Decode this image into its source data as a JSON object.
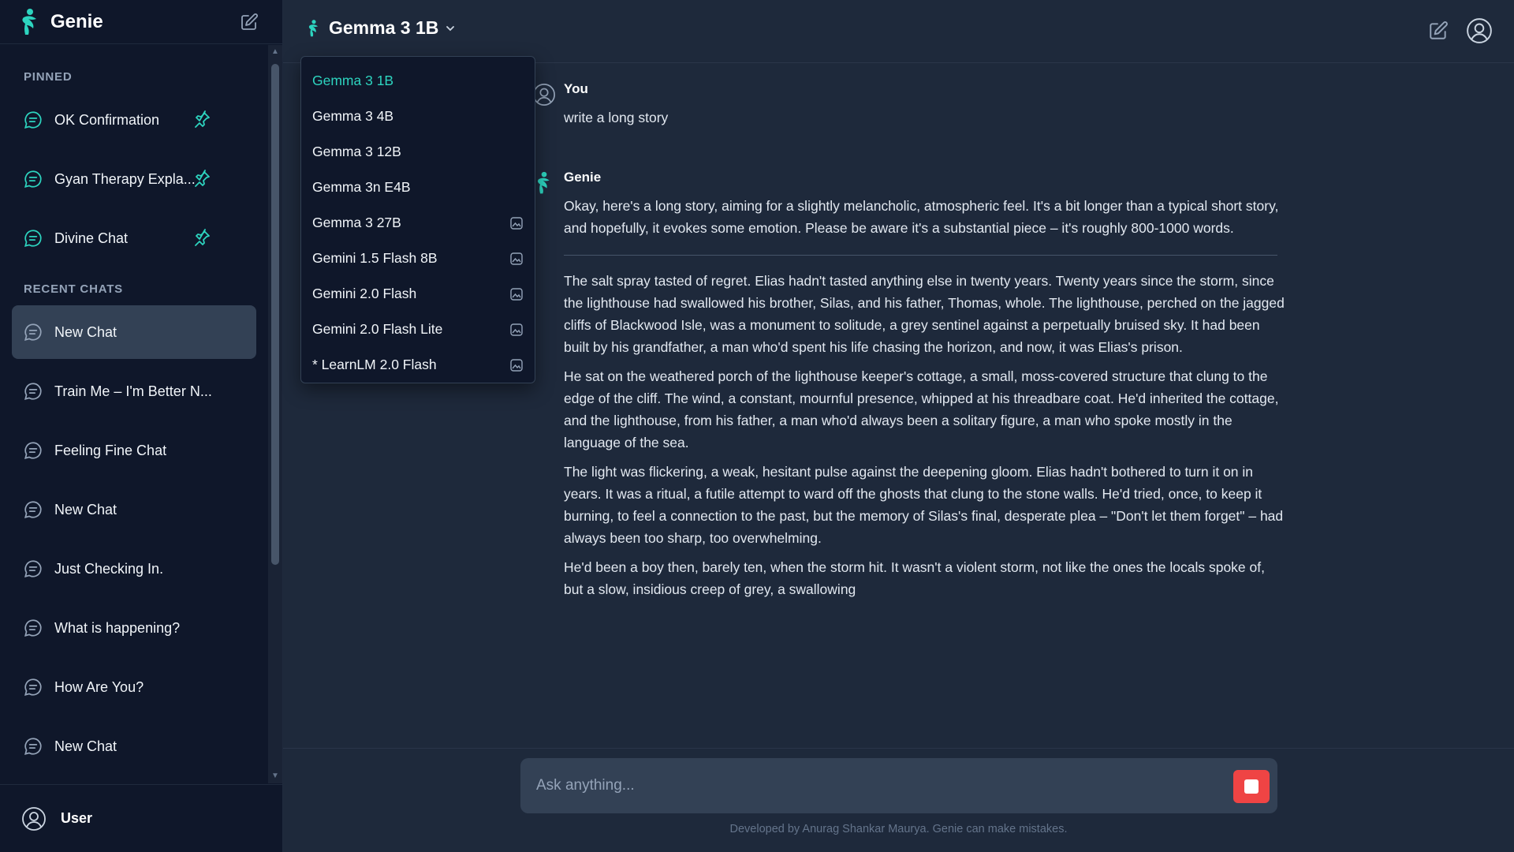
{
  "app": {
    "name": "Genie",
    "accent": "#2dd4bf"
  },
  "sidebar": {
    "pinned_label": "PINNED",
    "pinned": [
      {
        "label": "OK Confirmation"
      },
      {
        "label": "Gyan Therapy Expla..."
      },
      {
        "label": "Divine Chat"
      }
    ],
    "recent_label": "RECENT CHATS",
    "recent": [
      {
        "label": "New Chat",
        "active": true
      },
      {
        "label": "Train Me – I'm Better N..."
      },
      {
        "label": "Feeling Fine Chat"
      },
      {
        "label": "New Chat"
      },
      {
        "label": "Just Checking In."
      },
      {
        "label": "What is happening?"
      },
      {
        "label": "How Are You?"
      },
      {
        "label": "New Chat"
      }
    ],
    "user_name": "User"
  },
  "header": {
    "model_name": "Gemma 3 1B"
  },
  "dropdown": {
    "items": [
      {
        "label": "Gemma 3 1B",
        "selected": true,
        "image_support": false
      },
      {
        "label": "Gemma 3 4B",
        "image_support": false
      },
      {
        "label": "Gemma 3 12B",
        "image_support": false
      },
      {
        "label": "Gemma 3n E4B",
        "image_support": false
      },
      {
        "label": "Gemma 3 27B",
        "image_support": true
      },
      {
        "label": "Gemini 1.5 Flash 8B",
        "image_support": true
      },
      {
        "label": "Gemini 2.0 Flash",
        "image_support": true
      },
      {
        "label": "Gemini 2.0 Flash Lite",
        "image_support": true
      },
      {
        "label": "* LearnLM 2.0 Flash",
        "image_support": true
      }
    ]
  },
  "messages": {
    "user": {
      "author": "You",
      "text": "write a long story"
    },
    "assistant": {
      "author": "Genie",
      "intro": "Okay, here's a long story, aiming for a slightly melancholic, atmospheric feel. It's a bit longer than a typical short story, and hopefully, it evokes some emotion. Please be aware it's a substantial piece – it's roughly 800-1000 words.",
      "paragraphs": [
        "The salt spray tasted of regret. Elias hadn't tasted anything else in twenty years. Twenty years since the storm, since the lighthouse had swallowed his brother, Silas, and his father, Thomas, whole. The lighthouse, perched on the jagged cliffs of Blackwood Isle, was a monument to solitude, a grey sentinel against a perpetually bruised sky. It had been built by his grandfather, a man who'd spent his life chasing the horizon, and now, it was Elias's prison.",
        "He sat on the weathered porch of the lighthouse keeper's cottage, a small, moss-covered structure that clung to the edge of the cliff. The wind, a constant, mournful presence, whipped at his threadbare coat. He'd inherited the cottage, and the lighthouse, from his father, a man who'd always been a solitary figure, a man who spoke mostly in the language of the sea.",
        "The light was flickering, a weak, hesitant pulse against the deepening gloom. Elias hadn't bothered to turn it on in years. It was a ritual, a futile attempt to ward off the ghosts that clung to the stone walls. He'd tried, once, to keep it burning, to feel a connection to the past, but the memory of Silas's final, desperate plea – \"Don't let them forget\" – had always been too sharp, too overwhelming.",
        "He'd been a boy then, barely ten, when the storm hit. It wasn't a violent storm, not like the ones the locals spoke of, but a slow, insidious creep of grey, a swallowing"
      ]
    }
  },
  "composer": {
    "placeholder": "Ask anything..."
  },
  "footer_note": "Developed by Anurag Shankar Maurya. Genie can make mistakes."
}
